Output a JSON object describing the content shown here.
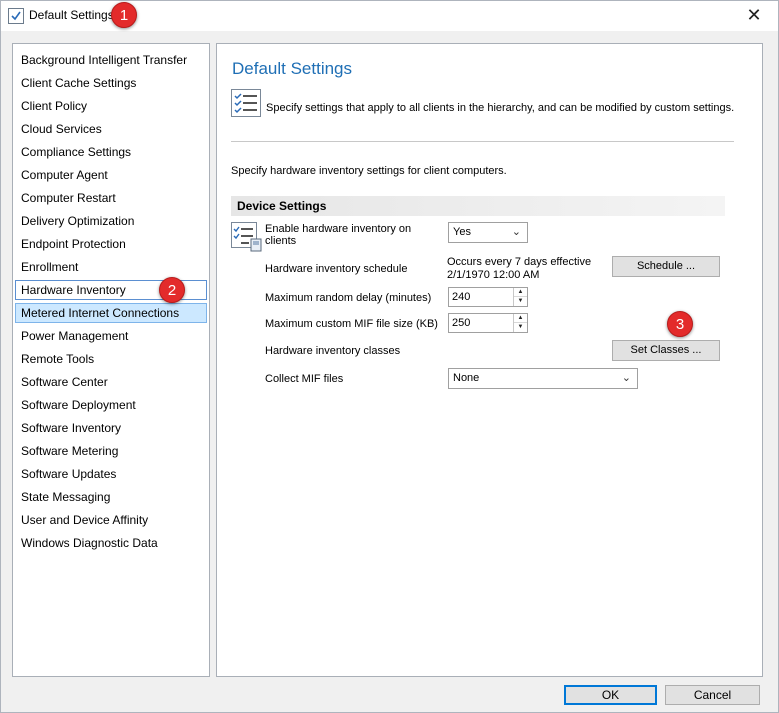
{
  "window": {
    "title": "Default Settings",
    "close_glyph": "✕"
  },
  "badges": [
    "1",
    "2",
    "3"
  ],
  "nav": {
    "items": [
      "Background Intelligent Transfer",
      "Client Cache Settings",
      "Client Policy",
      "Cloud Services",
      "Compliance Settings",
      "Computer Agent",
      "Computer Restart",
      "Delivery Optimization",
      "Endpoint Protection",
      "Enrollment",
      "Hardware Inventory",
      "Metered Internet Connections",
      "Power Management",
      "Remote Tools",
      "Software Center",
      "Software Deployment",
      "Software Inventory",
      "Software Metering",
      "Software Updates",
      "State Messaging",
      "User and Device Affinity",
      "Windows Diagnostic Data"
    ],
    "focused": "Hardware Inventory",
    "selected": "Metered Internet Connections"
  },
  "content": {
    "title": "Default Settings",
    "description": "Specify settings that apply to all clients in the hierarchy, and can be modified by custom settings.",
    "subdescription": "Specify hardware inventory settings for client computers.",
    "group_header": "Device Settings",
    "enable_label_line1": "Enable hardware inventory on",
    "enable_label_line2": "clients",
    "enable_value": "Yes",
    "schedule_label": "Hardware inventory schedule",
    "schedule_value_line1": "Occurs every 7 days effective",
    "schedule_value_line2": "2/1/1970 12:00 AM",
    "schedule_button": "Schedule ...",
    "delay_label": "Maximum random delay (minutes)",
    "delay_value": "240",
    "mif_size_label": "Maximum custom MIF file size (KB)",
    "mif_size_value": "250",
    "classes_label": "Hardware inventory classes",
    "classes_button": "Set Classes ...",
    "collect_mif_label": "Collect MIF files",
    "collect_mif_value": "None"
  },
  "footer": {
    "ok": "OK",
    "cancel": "Cancel"
  }
}
